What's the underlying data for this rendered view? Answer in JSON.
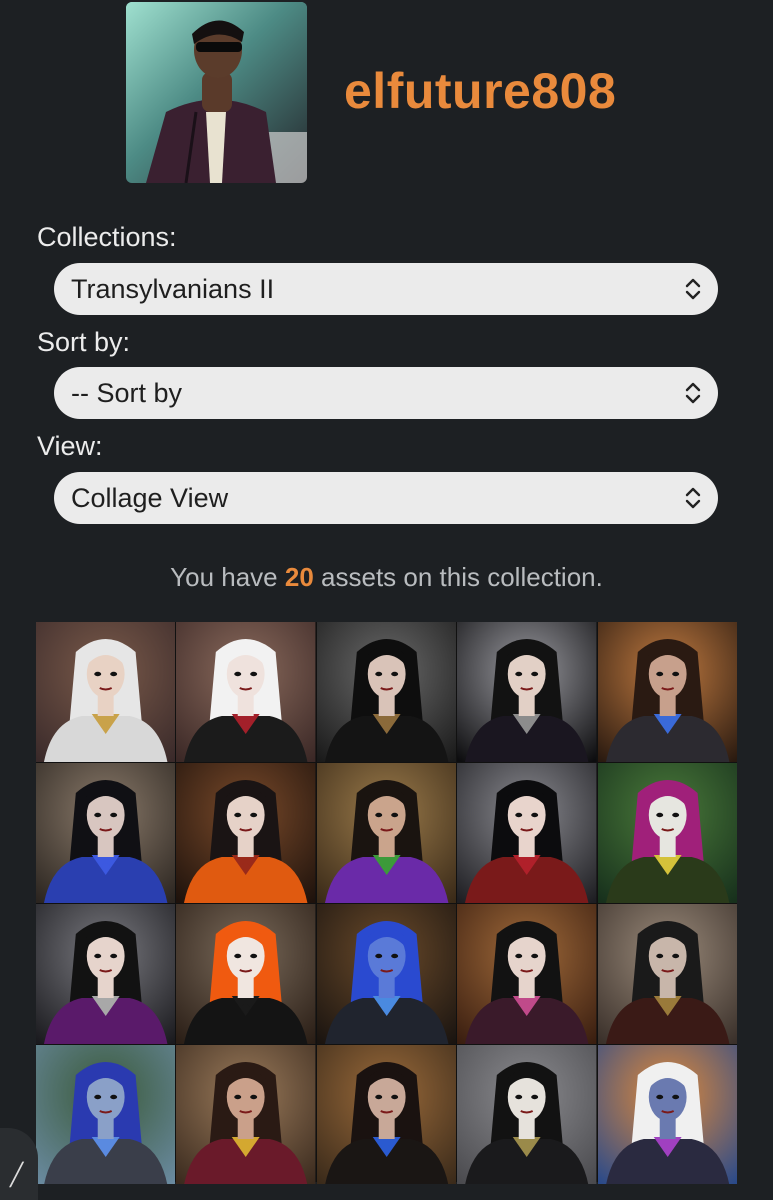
{
  "profile": {
    "username": "elfuture808"
  },
  "filters": {
    "collections_label": "Collections:",
    "collections_value": "Transylvanians II",
    "sort_label": "Sort by:",
    "sort_value": "-- Sort by",
    "view_label": "View:",
    "view_value": "Collage View"
  },
  "summary": {
    "prefix": "You have",
    "count": "20",
    "suffix": "assets on this collection."
  },
  "colors": {
    "accent": "#e98a3c",
    "background": "#1d2023",
    "select_bg": "#ebebeb"
  },
  "assets": [
    {
      "bg1": "#3a2a2a",
      "bg2": "#7a5a4a",
      "skin": "#e8d2c4",
      "hair": "#e6e6e6",
      "outfit": "#d8d8d8",
      "accent": "#c9a24a"
    },
    {
      "bg1": "#3b2826",
      "bg2": "#8a6a5c",
      "skin": "#efe2dd",
      "hair": "#f2f2f2",
      "outfit": "#1b1b1b",
      "accent": "#a3202a"
    },
    {
      "bg1": "#1a1a1a",
      "bg2": "#6a6a6a",
      "skin": "#d9c3b8",
      "hair": "#0e0e0e",
      "outfit": "#141414",
      "accent": "#8b6a3a"
    },
    {
      "bg1": "#0d0d0f",
      "bg2": "#9a9aa0",
      "skin": "#e2d0c6",
      "hair": "#121212",
      "outfit": "#1a1620",
      "accent": "#8c8c8c"
    },
    {
      "bg1": "#2a1a10",
      "bg2": "#c07a40",
      "skin": "#c7a08c",
      "hair": "#2a1a12",
      "outfit": "#2c2a30",
      "accent": "#3a6ad8"
    },
    {
      "bg1": "#2b2520",
      "bg2": "#8a7a6a",
      "skin": "#d8c6c0",
      "hair": "#101014",
      "outfit": "#2a3fb0",
      "accent": "#3c59e0"
    },
    {
      "bg1": "#1e120c",
      "bg2": "#7a4a2a",
      "skin": "#e6d2c8",
      "hair": "#1a1414",
      "outfit": "#e05a10",
      "accent": "#9a2a1a"
    },
    {
      "bg1": "#3a2a18",
      "bg2": "#9a7a4a",
      "skin": "#caa48c",
      "hair": "#1a1410",
      "outfit": "#6a2aa8",
      "accent": "#3c9a3a"
    },
    {
      "bg1": "#1e1e22",
      "bg2": "#8a8a90",
      "skin": "#e8d4cc",
      "hair": "#0c0c0e",
      "outfit": "#7a1a1a",
      "accent": "#b0202a"
    },
    {
      "bg1": "#17301c",
      "bg2": "#4a7a3a",
      "skin": "#e6e6e0",
      "hair": "#a0207a",
      "outfit": "#2a3a1a",
      "accent": "#d4c23a"
    },
    {
      "bg1": "#1a1a1e",
      "bg2": "#7a7a80",
      "skin": "#e6d4cc",
      "hair": "#121212",
      "outfit": "#5a1a6a",
      "accent": "#a8a8a8"
    },
    {
      "bg1": "#2a1e16",
      "bg2": "#7a6a5a",
      "skin": "#f0e6e0",
      "hair": "#f05a10",
      "outfit": "#141414",
      "accent": "#1a1a1a"
    },
    {
      "bg1": "#1a1410",
      "bg2": "#6a4a2a",
      "skin": "#5a7ad8",
      "hair": "#2a4ad0",
      "outfit": "#20242e",
      "accent": "#4a8ae0"
    },
    {
      "bg1": "#3a1e10",
      "bg2": "#a06a3a",
      "skin": "#e6d4cc",
      "hair": "#121212",
      "outfit": "#3a1a2a",
      "accent": "#c04a8a"
    },
    {
      "bg1": "#3a302a",
      "bg2": "#9a8a7a",
      "skin": "#c8b6aa",
      "hair": "#1a1a1a",
      "outfit": "#3a1a16",
      "accent": "#9a7a3a"
    },
    {
      "bg1": "#6a8aa0",
      "bg2": "#3a5a3a",
      "skin": "#8aa0c8",
      "hair": "#2a3ab0",
      "outfit": "#3a3e4a",
      "accent": "#5a8ae0"
    },
    {
      "bg1": "#3a2a1e",
      "bg2": "#9a7a5a",
      "skin": "#caa08a",
      "hair": "#2a1a14",
      "outfit": "#6a1a2a",
      "accent": "#d4a830"
    },
    {
      "bg1": "#3a2a1a",
      "bg2": "#9a6a3a",
      "skin": "#c8a898",
      "hair": "#1a1210",
      "outfit": "#1a1614",
      "accent": "#2a5ad0"
    },
    {
      "bg1": "#4a4a4e",
      "bg2": "#8a8a8e",
      "skin": "#e6e2dc",
      "hair": "#121212",
      "outfit": "#1a1a1c",
      "accent": "#9a8a4a"
    },
    {
      "bg1": "#2a4a8a",
      "bg2": "#e08a3a",
      "skin": "#6a7ab0",
      "hair": "#f0f0f0",
      "outfit": "#2a2a40",
      "accent": "#a040c0"
    }
  ]
}
